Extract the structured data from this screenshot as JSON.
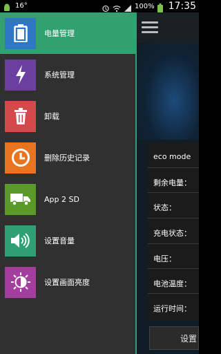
{
  "status_bar": {
    "temperature": "16°",
    "battery_pct": "100%",
    "time": "17:35"
  },
  "drawer": {
    "items": [
      {
        "label": "电量管理",
        "icon": "battery-icon",
        "color": "#2f76c4",
        "active": true
      },
      {
        "label": "系统管理",
        "icon": "lightning-icon",
        "color": "#6a3fa0",
        "active": false
      },
      {
        "label": "卸载",
        "icon": "trash-icon",
        "color": "#d44a4a",
        "active": false
      },
      {
        "label": "删除历史记录",
        "icon": "clock-icon",
        "color": "#e8741f",
        "active": false
      },
      {
        "label": "App 2 SD",
        "icon": "truck-icon",
        "color": "#5a9a2a",
        "active": false
      },
      {
        "label": "设置音量",
        "icon": "speaker-icon",
        "color": "#2fa073",
        "active": false
      },
      {
        "label": "设置画面亮度",
        "icon": "brightness-icon",
        "color": "#a33e9f",
        "active": false
      }
    ],
    "accent_color": "#33a070"
  },
  "info_panel": {
    "rows": [
      {
        "label": "eco mode"
      },
      {
        "label": "剩余电量："
      },
      {
        "label": "状态："
      },
      {
        "label": "充电状态："
      },
      {
        "label": "电压："
      },
      {
        "label": "电池温度："
      },
      {
        "label": "运行时间："
      }
    ],
    "button_label": "设置"
  }
}
